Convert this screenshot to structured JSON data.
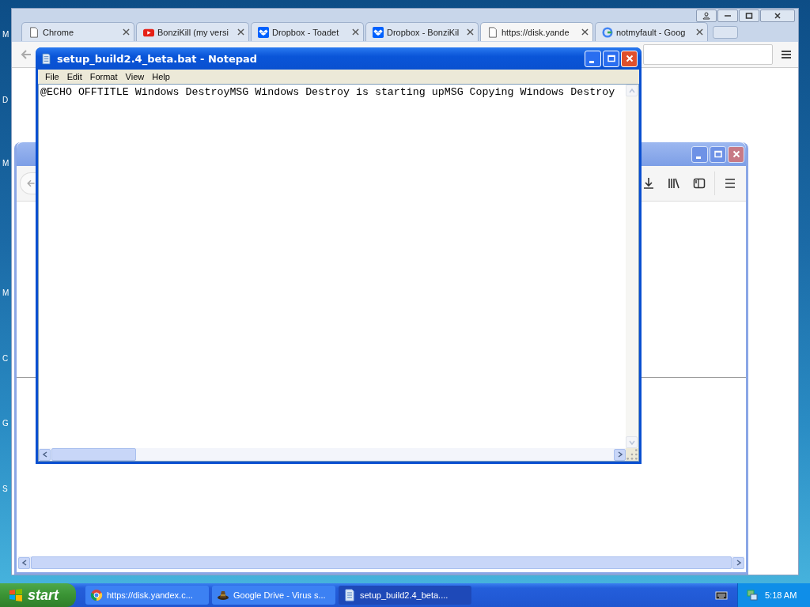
{
  "desktop": {
    "icon_labels": [
      {
        "text": "M"
      },
      {
        "text": "D"
      },
      {
        "text": "M"
      },
      {
        "text": "M"
      },
      {
        "text": "C"
      },
      {
        "text": "G"
      },
      {
        "text": "S"
      }
    ]
  },
  "browser": {
    "tabs": [
      {
        "title": "Chrome",
        "kind": "page",
        "selected": false
      },
      {
        "title": "BonziKill (my versi",
        "kind": "video",
        "selected": false
      },
      {
        "title": "Dropbox - Toadet",
        "kind": "box",
        "selected": false
      },
      {
        "title": "Dropbox - BonziKil",
        "kind": "box",
        "selected": false
      },
      {
        "title": "https://disk.yande",
        "kind": "page",
        "selected": true
      },
      {
        "title": "notmyfault - Goog",
        "kind": "search",
        "selected": false
      }
    ]
  },
  "notepad": {
    "title": "setup_build2.4_beta.bat - Notepad",
    "menu": [
      "File",
      "Edit",
      "Format",
      "View",
      "Help"
    ],
    "text": "@ECHO OFFTITLE Windows DestroyMSG Windows Destroy is starting upMSG Copying Windows Destroy"
  },
  "taskbar": {
    "start": "start",
    "tasks": [
      {
        "label": "https://disk.yandex.c...",
        "kind": "browser",
        "selected": false
      },
      {
        "label": "Google Drive - Virus s...",
        "kind": "game",
        "selected": false
      },
      {
        "label": "setup_build2.4_beta....",
        "kind": "notepad",
        "selected": true
      }
    ],
    "clock": "5:18 AM"
  }
}
